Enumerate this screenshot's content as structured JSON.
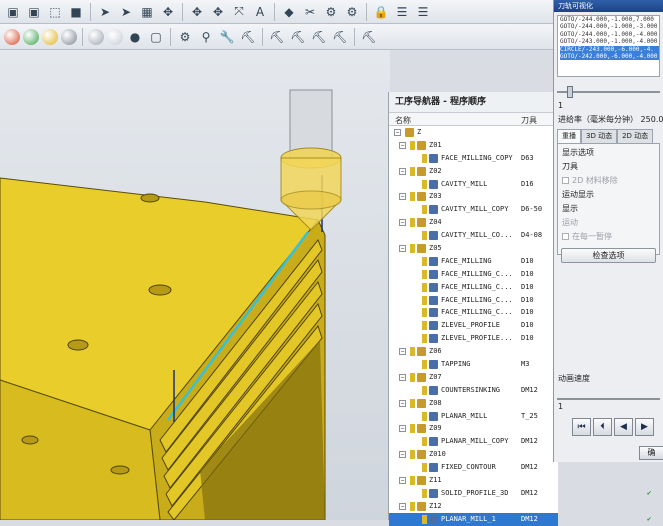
{
  "toolbar_top": {
    "icons": [
      "cube-icon",
      "cube-icon",
      "wireframe-cube-icon",
      "shaded-box-icon",
      "cursor-icon",
      "cursor-icon",
      "table-icon",
      "move-icon",
      "move-icon",
      "move-icon",
      "transform-icon",
      "text-icon",
      "diamond-icon",
      "scissors-icon",
      "gear-icon",
      "gear-icon",
      "lock-icon",
      "list-icon",
      "list-icon"
    ]
  },
  "toolbar_bottom": {
    "icons": [
      "ball-icon",
      "ball-icon",
      "ball-icon",
      "ball-icon",
      "ball-icon",
      "ball-icon",
      "sphere-icon",
      "box-icon",
      "gear-icon",
      "plug-icon",
      "wrench-icon",
      "tool-icon",
      "tool-icon",
      "tool-icon",
      "tool-icon",
      "tool-icon",
      "tool-icon"
    ]
  },
  "navigator": {
    "title": "工序导航器 - 程序顺序",
    "columns": {
      "name": "名称",
      "tool": "刀具"
    },
    "root": "Z",
    "rows": [
      {
        "indent": 1,
        "type": "group",
        "name": "Z01",
        "tool": ""
      },
      {
        "indent": 2,
        "type": "op",
        "name": "FACE_MILLING_COPY",
        "tool": "D63"
      },
      {
        "indent": 1,
        "type": "group",
        "name": "Z02",
        "tool": ""
      },
      {
        "indent": 2,
        "type": "op",
        "name": "CAVITY_MILL",
        "tool": "D16"
      },
      {
        "indent": 1,
        "type": "group",
        "name": "Z03",
        "tool": ""
      },
      {
        "indent": 2,
        "type": "op",
        "name": "CAVITY_MILL_COPY",
        "tool": "D6-50"
      },
      {
        "indent": 1,
        "type": "group",
        "name": "Z04",
        "tool": ""
      },
      {
        "indent": 2,
        "type": "op",
        "name": "CAVITY_MILL_CO...",
        "tool": "D4-08"
      },
      {
        "indent": 1,
        "type": "group",
        "name": "Z05",
        "tool": ""
      },
      {
        "indent": 2,
        "type": "op",
        "name": "FACE_MILLING",
        "tool": "D10"
      },
      {
        "indent": 2,
        "type": "op",
        "name": "FACE_MILLING_C...",
        "tool": "D10"
      },
      {
        "indent": 2,
        "type": "op",
        "name": "FACE_MILLING_C...",
        "tool": "D10"
      },
      {
        "indent": 2,
        "type": "op",
        "name": "FACE_MILLING_C...",
        "tool": "D10"
      },
      {
        "indent": 2,
        "type": "op",
        "name": "FACE_MILLING_C...",
        "tool": "D10"
      },
      {
        "indent": 2,
        "type": "op",
        "name": "ZLEVEL_PROFILE",
        "tool": "D10"
      },
      {
        "indent": 2,
        "type": "op",
        "name": "ZLEVEL_PROFILE...",
        "tool": "D10"
      },
      {
        "indent": 1,
        "type": "group",
        "name": "Z06",
        "tool": ""
      },
      {
        "indent": 2,
        "type": "op",
        "name": "TAPPING",
        "tool": "M3"
      },
      {
        "indent": 1,
        "type": "group",
        "name": "Z07",
        "tool": ""
      },
      {
        "indent": 2,
        "type": "op",
        "name": "COUNTERSINKING",
        "tool": "DM12"
      },
      {
        "indent": 1,
        "type": "group",
        "name": "Z08",
        "tool": ""
      },
      {
        "indent": 2,
        "type": "op",
        "name": "PLANAR_MILL",
        "tool": "T_25"
      },
      {
        "indent": 1,
        "type": "group",
        "name": "Z09",
        "tool": ""
      },
      {
        "indent": 2,
        "type": "op",
        "name": "PLANAR_MILL_COPY",
        "tool": "DM12"
      },
      {
        "indent": 1,
        "type": "group",
        "name": "Z010",
        "tool": ""
      },
      {
        "indent": 2,
        "type": "op",
        "name": "FIXED_CONTOUR",
        "tool": "DM12"
      },
      {
        "indent": 1,
        "type": "group",
        "name": "Z11",
        "tool": ""
      },
      {
        "indent": 2,
        "type": "op",
        "name": "SOLID_PROFILE_3D",
        "tool": "DM12",
        "check": "✔"
      },
      {
        "indent": 1,
        "type": "group",
        "name": "Z12",
        "tool": ""
      },
      {
        "indent": 2,
        "type": "op",
        "name": "PLANAR_MILL_1",
        "tool": "DM12",
        "check": "✔",
        "selected": true
      }
    ]
  },
  "dialog": {
    "title": "刀轨可视化",
    "gcode": [
      "GOTO/-244.000,-1.000,7.000",
      "GOTO/-244.000,-1.000,-3.000",
      "GOTO/-244.000,-1.000,-4.000",
      "GOTO/-243.000,-1.000,-4.000",
      "CIRCLE/-243.000,-6.000,-4.",
      "GOTO/-242.000,-6.000,-4.000"
    ],
    "highlight_lines": [
      4,
      5
    ],
    "slider_min": "1",
    "slider_mid": "1",
    "feed_label": "进给率（毫米每分钟）",
    "feed_value": "250.000",
    "tabs": [
      "重播",
      "3D 动态",
      "2D 动态"
    ],
    "active_tab": 0,
    "display_options_label": "显示选项",
    "tool_label": "刀具",
    "tool_checkbox": "2D 材料移除",
    "motion_display_label": "运动显示",
    "display_label": "显示",
    "motion_label": "运动",
    "pause_checkbox": "在每一暂停",
    "check_options_button": "检查选项",
    "anim_speed_label": "动画速度",
    "anim_speed_value": "1",
    "playback_buttons": [
      "⏮",
      "⏴",
      "◀",
      "▶"
    ],
    "confirm_label": "确"
  },
  "colors": {
    "part": "#e7c924",
    "part_dark": "#b39714",
    "toolpath": "#35c2d6",
    "selection": "#2f78d0",
    "tool": "#f2d75a"
  }
}
